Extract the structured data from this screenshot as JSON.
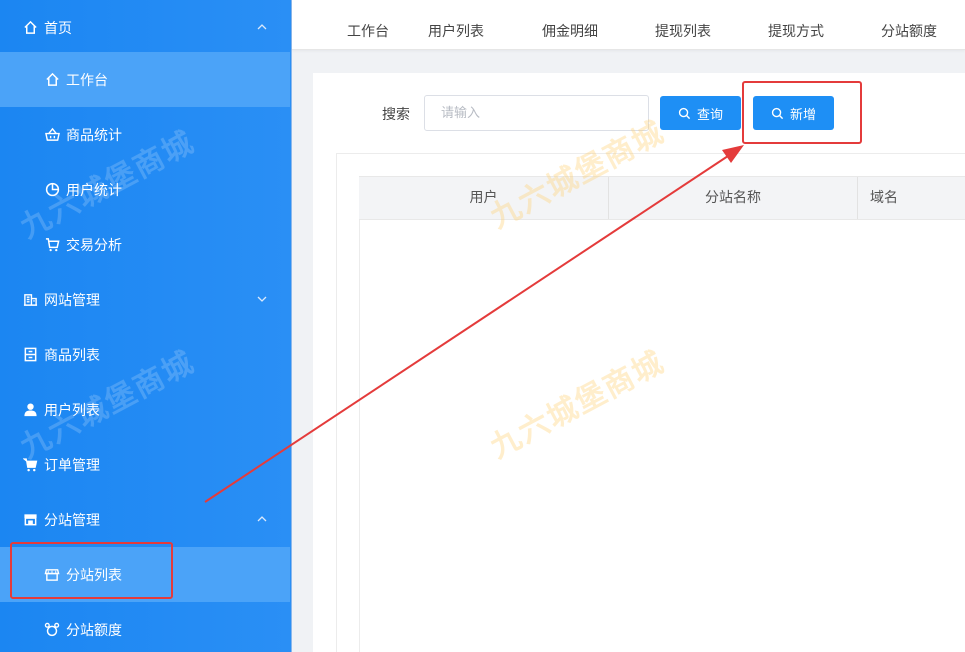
{
  "sidebar": {
    "items": [
      {
        "label": "首页",
        "icon": "home-icon",
        "chevron": "up"
      },
      {
        "label": "工作台",
        "icon": "home-icon",
        "active": true
      },
      {
        "label": "商品统计",
        "icon": "basket-icon"
      },
      {
        "label": "用户统计",
        "icon": "pie-chart-icon"
      },
      {
        "label": "交易分析",
        "icon": "cart-icon"
      },
      {
        "label": "网站管理",
        "icon": "building-icon",
        "chevron": "down"
      },
      {
        "label": "商品列表",
        "icon": "cabinet-icon"
      },
      {
        "label": "用户列表",
        "icon": "user-icon"
      },
      {
        "label": "订单管理",
        "icon": "cart-icon"
      },
      {
        "label": "分站管理",
        "icon": "store-icon",
        "chevron": "up"
      },
      {
        "label": "分站列表",
        "icon": "shop-icon",
        "active": true
      },
      {
        "label": "分站额度",
        "icon": "wallet-icon"
      }
    ]
  },
  "tabs": [
    "工作台",
    "用户列表",
    "佣金明细",
    "提现列表",
    "提现方式",
    "分站额度"
  ],
  "search": {
    "label": "搜索",
    "placeholder": "请输入",
    "query_button": "查询",
    "add_button": "新增"
  },
  "table": {
    "columns": [
      "用户",
      "分站名称",
      "域名"
    ]
  },
  "watermark": "九六城堡商城",
  "colors": {
    "sidebar": "#1b86f2",
    "sidebar_active": "#4ba3f8",
    "primary_button": "#1e8ff5",
    "annotation_red": "#e43b3b",
    "watermark": "#ffcd6e"
  }
}
